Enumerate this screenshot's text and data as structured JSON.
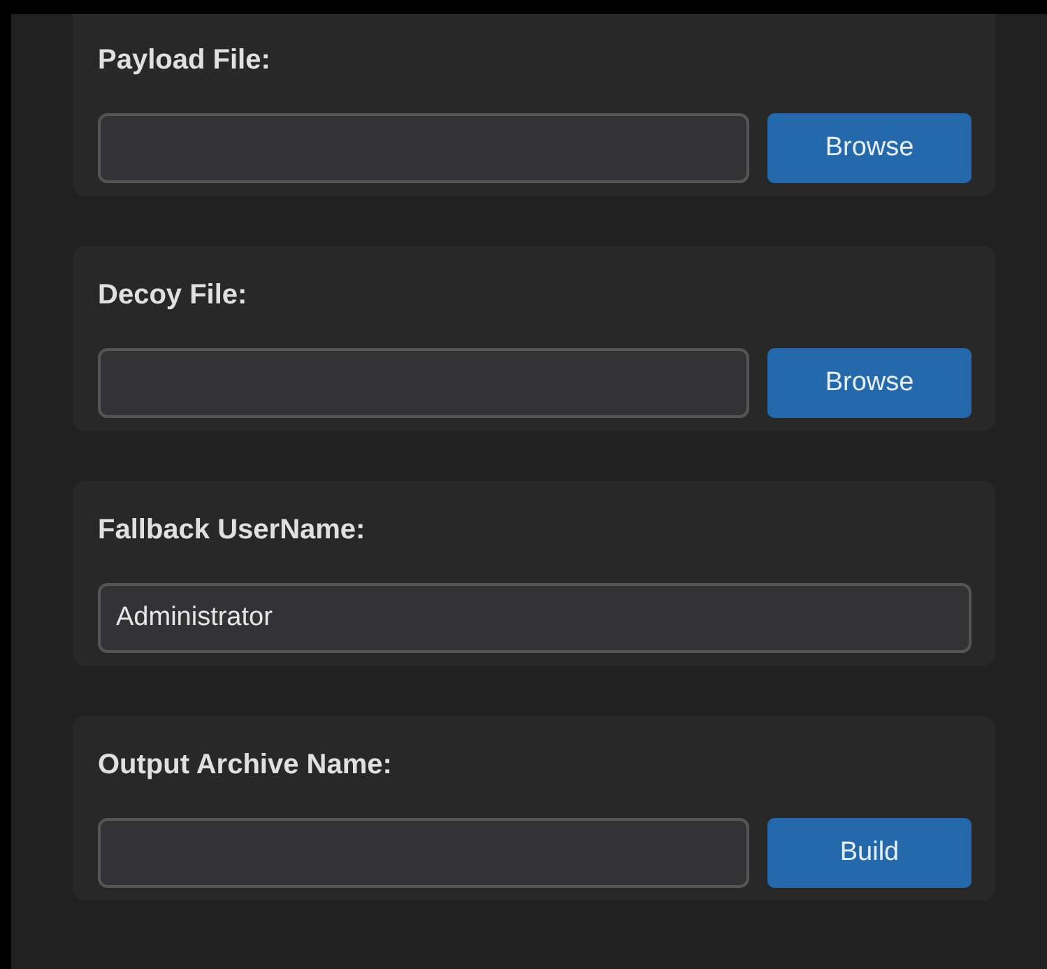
{
  "sections": [
    {
      "label": "Payload File:",
      "button": "Browse"
    },
    {
      "label": "Decoy File:",
      "button": "Browse"
    },
    {
      "label": "Fallback UserName:",
      "field": {
        "value": "Administrator"
      }
    },
    {
      "label": "Output Archive Name:",
      "button": "Build"
    }
  ]
}
